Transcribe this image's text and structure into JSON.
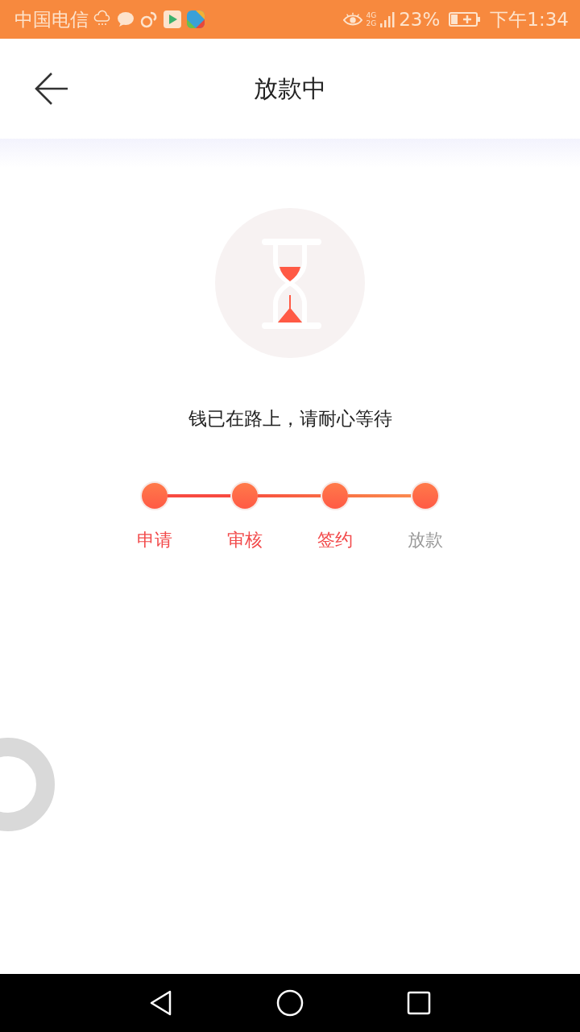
{
  "status_bar": {
    "carrier": "中国电信",
    "network_top": "4G",
    "network_bottom": "2G",
    "battery": "23%",
    "time": "下午1:34"
  },
  "header": {
    "title": "放款中"
  },
  "message": "钱已在路上，请耐心等待",
  "steps": [
    {
      "label": "申请",
      "done": true
    },
    {
      "label": "审核",
      "done": true
    },
    {
      "label": "签约",
      "done": true
    },
    {
      "label": "放款",
      "done": false
    }
  ]
}
